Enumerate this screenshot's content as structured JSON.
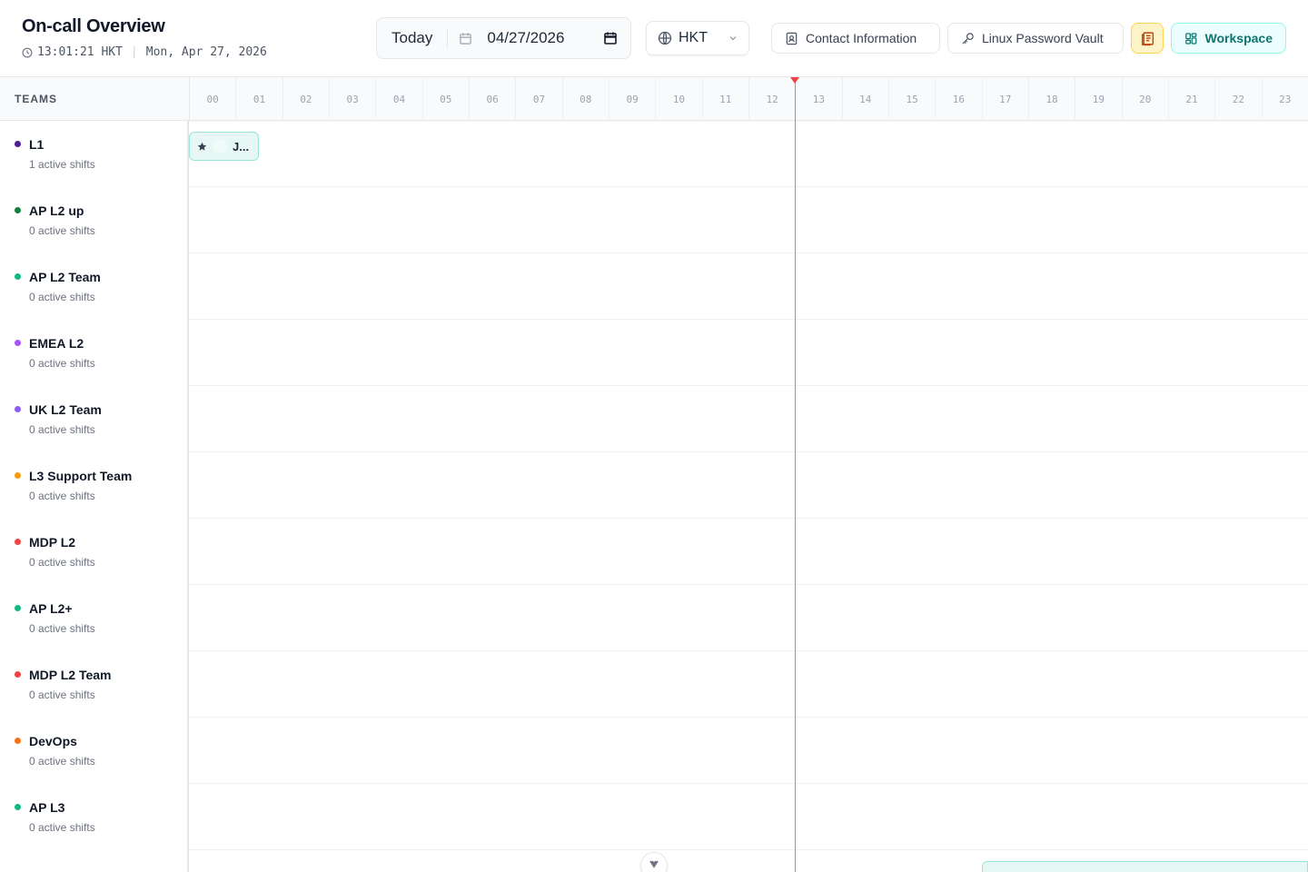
{
  "header": {
    "title": "On-call Overview",
    "time": "13:01:21 HKT",
    "date_text": "Mon, Apr 27, 2026",
    "today_label": "Today",
    "date_value": "04/27/2026",
    "timezone": "HKT",
    "contact_label": "Contact Information",
    "vault_label": "Linux Password Vault",
    "workspace_label": "Workspace"
  },
  "grid": {
    "teams_label": "TEAMS",
    "hours": [
      "00",
      "01",
      "02",
      "03",
      "04",
      "05",
      "06",
      "07",
      "08",
      "09",
      "10",
      "11",
      "12",
      "13",
      "14",
      "15",
      "16",
      "17",
      "18",
      "19",
      "20",
      "21",
      "22",
      "23"
    ],
    "teams": [
      {
        "name": "L1",
        "count": "1 active shifts",
        "color": "#4c1d95"
      },
      {
        "name": "AP L2 up",
        "count": "0 active shifts",
        "color": "#15803d"
      },
      {
        "name": "AP L2 Team",
        "count": "0 active shifts",
        "color": "#10b981"
      },
      {
        "name": "EMEA L2",
        "count": "0 active shifts",
        "color": "#a855f7"
      },
      {
        "name": "UK L2 Team",
        "count": "0 active shifts",
        "color": "#8b5cf6"
      },
      {
        "name": "L3 Support Team",
        "count": "0 active shifts",
        "color": "#f59e0b"
      },
      {
        "name": "MDP L2",
        "count": "0 active shifts",
        "color": "#ef4444"
      },
      {
        "name": "AP L2+",
        "count": "0 active shifts",
        "color": "#10b981"
      },
      {
        "name": "MDP L2 Team",
        "count": "0 active shifts",
        "color": "#ef4444"
      },
      {
        "name": "DevOps",
        "count": "0 active shifts",
        "color": "#f97316"
      },
      {
        "name": "AP L3",
        "count": "0 active shifts",
        "color": "#10b981"
      }
    ],
    "shift_chip": {
      "label": "J..."
    }
  },
  "colors": {
    "accent": "#0f766e",
    "now_line": "#ef4444"
  },
  "icons": {
    "clock": "clock-icon",
    "calendar": "calendar-icon",
    "picker": "calendar-picker-icon",
    "globe": "globe-icon",
    "chevron": "chevron-down-icon",
    "contact": "contact-card-icon",
    "key": "key-icon",
    "notes": "notes-icon",
    "workspace": "grid-icon",
    "star": "star-icon",
    "scroll": "chevron-down-icon"
  }
}
